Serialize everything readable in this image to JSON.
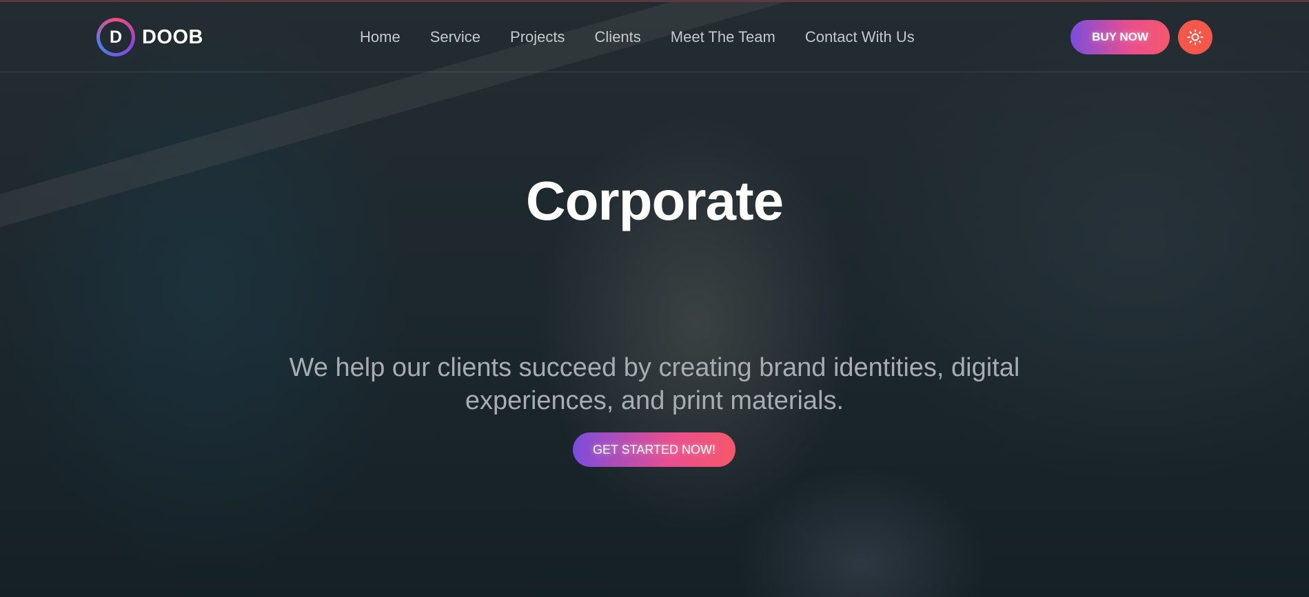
{
  "brand": {
    "logo_letter": "D",
    "name": "DOOB"
  },
  "nav": {
    "items": [
      {
        "label": "Home"
      },
      {
        "label": "Service"
      },
      {
        "label": "Projects"
      },
      {
        "label": "Clients"
      },
      {
        "label": "Meet The Team"
      },
      {
        "label": "Contact With Us"
      }
    ]
  },
  "header_actions": {
    "buy_label": "BUY NOW",
    "theme_icon": "sun-icon"
  },
  "hero": {
    "title": "Corporate",
    "description": "We help our clients succeed by creating brand identities, digital experiences, and print materials.",
    "cta_label": "GET STARTED NOW!"
  },
  "colors": {
    "accent_gradient_start": "#7c4ddb",
    "accent_gradient_mid": "#e94f8e",
    "accent_gradient_end": "#f5576c",
    "theme_button": "#f4584a"
  }
}
